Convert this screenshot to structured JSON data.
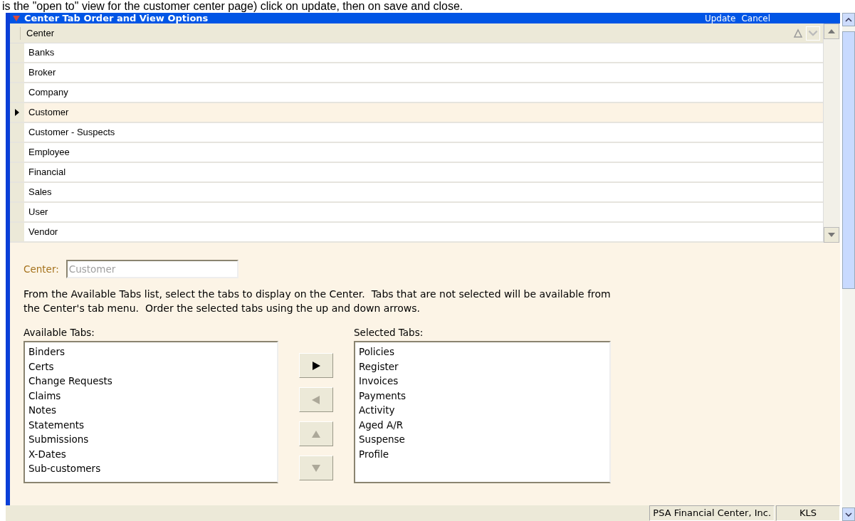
{
  "caption": "is the \"open to\" view for the customer center page) click on update, then on save and close.",
  "window": {
    "title": "Center Tab Order and View Options",
    "actions": [
      "Update",
      "Cancel"
    ]
  },
  "grid": {
    "columns": [
      "Center"
    ],
    "rows": [
      {
        "name": "Banks",
        "selected": false
      },
      {
        "name": "Broker",
        "selected": false
      },
      {
        "name": "Company",
        "selected": false
      },
      {
        "name": "Customer",
        "selected": true
      },
      {
        "name": "Customer - Suspects",
        "selected": false
      },
      {
        "name": "Employee",
        "selected": false
      },
      {
        "name": "Financial",
        "selected": false
      },
      {
        "name": "Sales",
        "selected": false
      },
      {
        "name": "User",
        "selected": false
      },
      {
        "name": "Vendor",
        "selected": false
      }
    ]
  },
  "center_field": {
    "label": "Center:",
    "value": "Customer",
    "disabled": true
  },
  "instructions": "From the Available Tabs list, select the tabs to display on the Center.  Tabs that are not selected will be available from the Center's tab menu.  Order the selected tabs using the up and down arrows.",
  "available": {
    "label": "Available Tabs:",
    "items": [
      "Binders",
      "Certs",
      "Change Requests",
      "Claims",
      "Notes",
      "Statements",
      "Submissions",
      "X-Dates",
      "Sub-customers"
    ]
  },
  "move_buttons": [
    {
      "kind": "right",
      "disabled": false
    },
    {
      "kind": "left",
      "disabled": true
    },
    {
      "kind": "up",
      "disabled": true
    },
    {
      "kind": "down",
      "disabled": true
    }
  ],
  "selected": {
    "label": "Selected Tabs:",
    "items": [
      "Policies",
      "Register",
      "Invoices",
      "Payments",
      "Activity",
      "Aged A/R",
      "Suspense",
      "Profile"
    ]
  },
  "status_bar": [
    "PSA Financial Center, Inc.",
    "KLS"
  ]
}
